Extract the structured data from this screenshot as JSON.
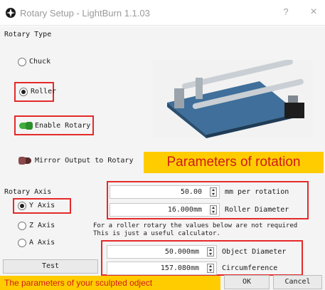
{
  "window": {
    "title": "Rotary Setup - LightBurn 1.1.03",
    "help_label": "?",
    "close_label": "×"
  },
  "rotary_type": {
    "heading": "Rotary Type",
    "chuck_label": "Chuck",
    "roller_label": "Roller",
    "selected": "Roller"
  },
  "toggles": {
    "enable_rotary_label": "Enable Rotary",
    "enable_rotary_on": true,
    "mirror_output_label": "Mirror Output to Rotary",
    "mirror_output_on": false
  },
  "rotary_axis": {
    "heading": "Rotary Axis",
    "options": [
      "Y Axis",
      "Z Axis",
      "A Axis"
    ],
    "selected": "Y Axis"
  },
  "settings": {
    "mm_per_rotation_value": "50.00",
    "mm_per_rotation_label": "mm per rotation",
    "roller_diameter_value": "16.000mm",
    "roller_diameter_label": "Roller Diameter"
  },
  "calculator": {
    "note_line1": "For a roller rotary the values below are not required",
    "note_line2": "This is just a useful calculator.",
    "object_diameter_value": "50.000mm",
    "object_diameter_label": "Object Diameter",
    "circumference_value": "157.080mm",
    "circumference_label": "Circumference"
  },
  "buttons": {
    "test": "Test",
    "ok": "OK",
    "cancel": "Cancel"
  },
  "annotations": {
    "parameters_of_rotation": "Parameters of rotation",
    "sculpted_object_params": "The parameters of your sculpted odject"
  },
  "colors": {
    "annotation_red": "#e52a2a",
    "annotation_yellow": "#ffcc00",
    "enable_toggle_green": "#3cae3c",
    "mirror_toggle_dark_red": "#5a2a2a"
  },
  "icons": {
    "app": "lightburn-logo-icon",
    "product": "roller-rotary-photo"
  }
}
